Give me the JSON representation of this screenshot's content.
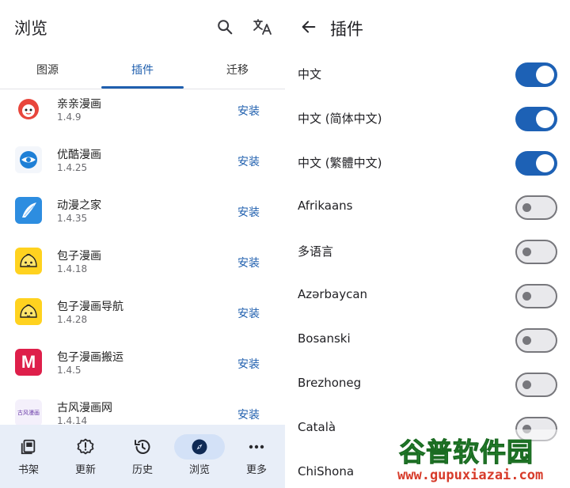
{
  "left": {
    "title": "浏览",
    "tabs": [
      {
        "label": "图源"
      },
      {
        "label": "插件"
      },
      {
        "label": "迁移"
      }
    ],
    "extensions": [
      {
        "name": "亲亲漫画",
        "version": "1.4.9",
        "action": "安装",
        "icon": "qinqin-logo"
      },
      {
        "name": "优酷漫画",
        "version": "1.4.25",
        "action": "安装",
        "icon": "youku-logo"
      },
      {
        "name": "动漫之家",
        "version": "1.4.35",
        "action": "安装",
        "icon": "dmzj-logo"
      },
      {
        "name": "包子漫画",
        "version": "1.4.18",
        "action": "安装",
        "icon": "baozi-logo"
      },
      {
        "name": "包子漫画导航",
        "version": "1.4.28",
        "action": "安装",
        "icon": "baozi-logo"
      },
      {
        "name": "包子漫画搬运",
        "version": "1.4.5",
        "action": "安装",
        "icon": "m-logo"
      },
      {
        "name": "古风漫画网",
        "version": "1.4.14",
        "action": "安装",
        "icon": "gufeng-logo"
      }
    ],
    "gufeng_logo_text": "古风漫画",
    "m_logo_text": "M",
    "bottom_nav": [
      {
        "label": "书架",
        "icon": "bookshelf-icon"
      },
      {
        "label": "更新",
        "icon": "alert-icon"
      },
      {
        "label": "历史",
        "icon": "history-icon"
      },
      {
        "label": "浏览",
        "icon": "compass-icon"
      },
      {
        "label": "更多",
        "icon": "more-icon"
      }
    ]
  },
  "right": {
    "title": "插件",
    "languages": [
      {
        "label": "中文",
        "enabled": true
      },
      {
        "label": "中文 (简体中文)",
        "enabled": true
      },
      {
        "label": "中文 (繁體中文)",
        "enabled": true
      },
      {
        "label": "Afrikaans",
        "enabled": false
      },
      {
        "label": "多语言",
        "enabled": false
      },
      {
        "label": "Azərbaycan",
        "enabled": false
      },
      {
        "label": "Bosanski",
        "enabled": false
      },
      {
        "label": "Brezhoneg",
        "enabled": false
      },
      {
        "label": "Català",
        "enabled": false
      },
      {
        "label": "ChiShona",
        "enabled": false
      }
    ]
  },
  "watermark": {
    "name": "谷普软件园",
    "url": "www.gupuxiazai.com"
  },
  "colors": {
    "accent": "#1f5fae",
    "toggle_on": "#1d61b5",
    "nav_bg": "#e8eef8"
  }
}
